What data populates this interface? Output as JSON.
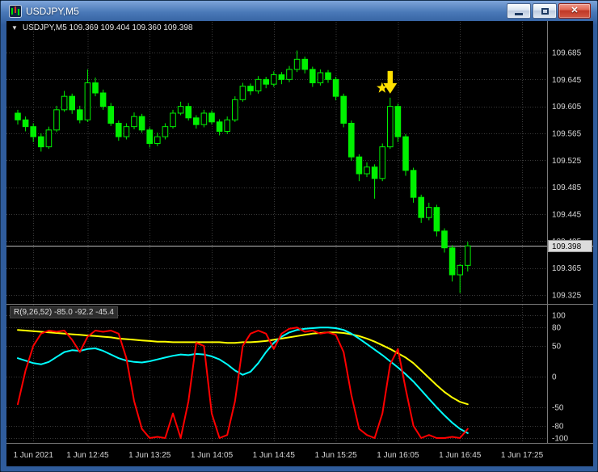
{
  "window": {
    "title": "USDJPY,M5"
  },
  "icons": {
    "symbol_dropdown": "▼",
    "close": "✕",
    "minimize": "minimize-bar",
    "maximize": "maximize-box",
    "app": "candlestick-chart"
  },
  "chart_data": [
    {
      "type": "candlestick",
      "symbol": "USDJPY",
      "timeframe": "M5",
      "ohlc_line": "USDJPY,M5  109.369 109.404 109.360 109.398",
      "ohlc_header": {
        "open": "109.369",
        "high": "109.404",
        "low": "109.360",
        "close": "109.398"
      },
      "price_axis": {
        "max": 109.685,
        "min": 109.325,
        "labels": [
          "109.685",
          "109.645",
          "109.605",
          "109.565",
          "109.525",
          "109.485",
          "109.445",
          "109.405",
          "109.365",
          "109.325"
        ]
      },
      "bid": {
        "value": 109.398,
        "label": "109.398"
      },
      "time_axis": {
        "ticks": [
          {
            "index": 2,
            "label": "1 Jun 2021"
          },
          {
            "index": 9,
            "label": "1 Jun 12:45"
          },
          {
            "index": 17,
            "label": "1 Jun 13:25"
          },
          {
            "index": 25,
            "label": "1 Jun 14:05"
          },
          {
            "index": 33,
            "label": "1 Jun 14:45"
          },
          {
            "index": 41,
            "label": "1 Jun 15:25"
          },
          {
            "index": 49,
            "label": "1 Jun 16:05"
          },
          {
            "index": 57,
            "label": "1 Jun 16:45"
          },
          {
            "index": 65,
            "label": "1 Jun 17:25"
          }
        ]
      },
      "signal": {
        "candle_index": 48,
        "type": "sell-arrow-down",
        "color": "#FFE000",
        "star": true
      },
      "colors": {
        "up": "#00F000",
        "down": "#00F000",
        "background": "#000000",
        "grid": "#3A3A3A",
        "bid_line": "#B8B8B8"
      },
      "candles": [
        [
          109.595,
          109.6,
          109.578,
          109.585
        ],
        [
          109.585,
          109.59,
          109.568,
          109.575
        ],
        [
          109.575,
          109.58,
          109.552,
          109.56
        ],
        [
          109.56,
          109.565,
          109.538,
          109.545
        ],
        [
          109.545,
          109.575,
          109.542,
          109.57
        ],
        [
          109.57,
          109.606,
          109.567,
          109.6
        ],
        [
          109.6,
          109.628,
          109.597,
          109.62
        ],
        [
          109.62,
          109.624,
          109.594,
          109.6
        ],
        [
          109.6,
          109.606,
          109.58,
          109.585
        ],
        [
          109.585,
          109.66,
          109.582,
          109.64
        ],
        [
          109.64,
          109.648,
          109.62,
          109.625
        ],
        [
          109.625,
          109.63,
          109.6,
          109.605
        ],
        [
          109.605,
          109.61,
          109.576,
          109.58
        ],
        [
          109.58,
          109.584,
          109.554,
          109.56
        ],
        [
          109.56,
          109.58,
          109.556,
          109.575
        ],
        [
          109.575,
          109.596,
          109.571,
          109.59
        ],
        [
          109.59,
          109.594,
          109.566,
          109.57
        ],
        [
          109.57,
          109.574,
          109.544,
          109.55
        ],
        [
          109.55,
          109.566,
          109.546,
          109.56
        ],
        [
          109.56,
          109.58,
          109.556,
          109.575
        ],
        [
          109.575,
          109.6,
          109.572,
          109.595
        ],
        [
          109.595,
          109.612,
          109.592,
          109.605
        ],
        [
          109.605,
          109.61,
          109.584,
          109.588
        ],
        [
          109.588,
          109.592,
          109.572,
          109.578
        ],
        [
          109.578,
          109.6,
          109.574,
          109.595
        ],
        [
          109.595,
          109.599,
          109.578,
          109.582
        ],
        [
          109.582,
          109.586,
          109.562,
          109.568
        ],
        [
          109.568,
          109.59,
          109.564,
          109.585
        ],
        [
          109.585,
          109.62,
          109.582,
          109.615
        ],
        [
          109.615,
          109.64,
          109.612,
          109.635
        ],
        [
          109.635,
          109.639,
          109.622,
          109.628
        ],
        [
          109.628,
          109.65,
          109.624,
          109.645
        ],
        [
          109.645,
          109.649,
          109.632,
          109.638
        ],
        [
          109.638,
          109.657,
          109.634,
          109.652
        ],
        [
          109.652,
          109.656,
          109.638,
          109.645
        ],
        [
          109.645,
          109.665,
          109.641,
          109.66
        ],
        [
          109.66,
          109.688,
          109.656,
          109.675
        ],
        [
          109.675,
          109.679,
          109.654,
          109.66
        ],
        [
          109.66,
          109.664,
          109.634,
          109.64
        ],
        [
          109.64,
          109.66,
          109.636,
          109.655
        ],
        [
          109.655,
          109.659,
          109.64,
          109.645
        ],
        [
          109.645,
          109.649,
          109.614,
          109.62
        ],
        [
          109.62,
          109.624,
          109.574,
          109.58
        ],
        [
          109.58,
          109.584,
          109.524,
          109.53
        ],
        [
          109.53,
          109.534,
          109.494,
          109.505
        ],
        [
          109.505,
          109.522,
          109.5,
          109.515
        ],
        [
          109.515,
          109.519,
          109.468,
          109.498
        ],
        [
          109.498,
          109.55,
          109.494,
          109.545
        ],
        [
          109.545,
          109.618,
          109.542,
          109.605
        ],
        [
          109.605,
          109.609,
          109.552,
          109.56
        ],
        [
          109.56,
          109.564,
          109.502,
          109.51
        ],
        [
          109.51,
          109.514,
          109.462,
          109.47
        ],
        [
          109.47,
          109.474,
          109.432,
          109.44
        ],
        [
          109.44,
          109.462,
          109.436,
          109.455
        ],
        [
          109.455,
          109.459,
          109.412,
          109.42
        ],
        [
          109.42,
          109.424,
          109.388,
          109.395
        ],
        [
          109.395,
          109.399,
          109.345,
          109.355
        ],
        [
          109.355,
          109.371,
          109.328,
          109.369
        ],
        [
          109.369,
          109.404,
          109.36,
          109.398
        ]
      ]
    },
    {
      "type": "line",
      "name": "R(9,26,52)",
      "label_line": "R(9,26,52) -85.0 -92.2 -45.4",
      "values_display": [
        "-85.0",
        "-92.2",
        "-45.4"
      ],
      "scale": {
        "max": 100,
        "min": -100,
        "labels": [
          "100",
          "80",
          "50",
          "0",
          "-50",
          "-80",
          "-100"
        ]
      },
      "series": [
        {
          "name": "R52",
          "color": "#FFFF00",
          "values": [
            76,
            75,
            74,
            73,
            72,
            71,
            70,
            69,
            68,
            67,
            66,
            65,
            64,
            62,
            61,
            60,
            59,
            58,
            57,
            57,
            56,
            56,
            56,
            56,
            56,
            56,
            56,
            55,
            55,
            56,
            56,
            57,
            58,
            60,
            62,
            64,
            66,
            68,
            70,
            71,
            72,
            72,
            71,
            69,
            66,
            62,
            57,
            51,
            45,
            38,
            31,
            22,
            10,
            -2,
            -14,
            -25,
            -34,
            -41,
            -45
          ]
        },
        {
          "name": "R26",
          "color": "#00FFFF",
          "values": [
            30,
            26,
            22,
            20,
            24,
            32,
            40,
            43,
            42,
            45,
            46,
            42,
            36,
            30,
            26,
            24,
            23,
            25,
            28,
            31,
            34,
            36,
            35,
            37,
            36,
            33,
            28,
            20,
            10,
            3,
            8,
            22,
            40,
            55,
            65,
            72,
            76,
            78,
            79,
            80,
            80,
            79,
            76,
            70,
            62,
            53,
            44,
            35,
            25,
            15,
            4,
            -8,
            -22,
            -36,
            -50,
            -63,
            -75,
            -85,
            -92
          ]
        },
        {
          "name": "R9",
          "color": "#FF0000",
          "values": [
            -45,
            10,
            50,
            70,
            75,
            73,
            75,
            60,
            40,
            65,
            75,
            73,
            75,
            70,
            30,
            -40,
            -85,
            -100,
            -98,
            -100,
            -60,
            -100,
            -40,
            55,
            50,
            -60,
            -100,
            -95,
            -40,
            50,
            70,
            75,
            70,
            45,
            70,
            78,
            80,
            73,
            75,
            70,
            72,
            68,
            40,
            -30,
            -85,
            -95,
            -100,
            -60,
            20,
            45,
            -20,
            -80,
            -100,
            -95,
            -100,
            -100,
            -98,
            -100,
            -85
          ]
        }
      ]
    }
  ]
}
